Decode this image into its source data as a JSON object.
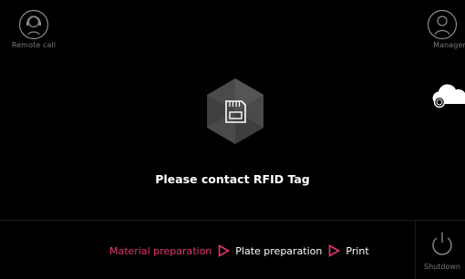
{
  "topbar": {
    "remote_call": {
      "label": "Remote call",
      "icon": "headset-icon"
    },
    "manager": {
      "label": "Manager",
      "icon": "user-icon"
    },
    "cloud": {
      "icon": "cloud-icon"
    }
  },
  "main": {
    "badge_icon": "sd-card-icon",
    "prompt": "Please contact RFID Tag"
  },
  "footer": {
    "steps": [
      {
        "label": "Material preparation",
        "active": true
      },
      {
        "label": "Plate preparation",
        "active": false
      },
      {
        "label": "Print",
        "active": false
      }
    ],
    "shutdown": {
      "label": "Shutdown",
      "icon": "power-icon"
    }
  },
  "colors": {
    "background": "#000000",
    "accent": "#e8336f",
    "muted_label": "#7a7a7a",
    "badge": "#4a4a4a"
  }
}
